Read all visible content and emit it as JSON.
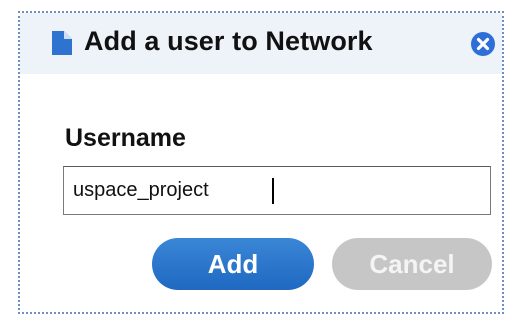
{
  "dialog": {
    "title": "Add a user to Network",
    "title_icon": "document-icon",
    "close_icon": "close-circle-icon",
    "username_label": "Username",
    "username_value": "uspace_project",
    "add_label": "Add",
    "cancel_label": "Cancel"
  },
  "colors": {
    "titlebar_bg": "#eef3fa",
    "border": "#6f8fc0",
    "add_button": "#2b78cf",
    "cancel_button": "#c6c6c6",
    "close_icon": "#2d6fd6"
  }
}
